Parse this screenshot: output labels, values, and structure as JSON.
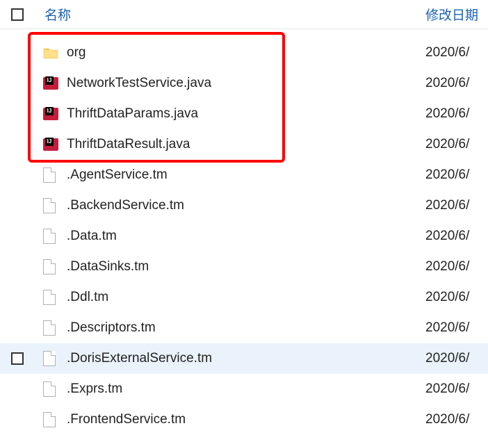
{
  "header": {
    "name_label": "名称",
    "date_label": "修改日期"
  },
  "rows": [
    {
      "type": "folder",
      "name": "org",
      "date": "2020/6/",
      "selected": false,
      "show_checkbox": false
    },
    {
      "type": "java",
      "name": "NetworkTestService.java",
      "date": "2020/6/",
      "selected": false,
      "show_checkbox": false
    },
    {
      "type": "java",
      "name": "ThriftDataParams.java",
      "date": "2020/6/",
      "selected": false,
      "show_checkbox": false
    },
    {
      "type": "java",
      "name": "ThriftDataResult.java",
      "date": "2020/6/",
      "selected": false,
      "show_checkbox": false
    },
    {
      "type": "file",
      "name": ".AgentService.tm",
      "date": "2020/6/",
      "selected": false,
      "show_checkbox": false
    },
    {
      "type": "file",
      "name": ".BackendService.tm",
      "date": "2020/6/",
      "selected": false,
      "show_checkbox": false
    },
    {
      "type": "file",
      "name": ".Data.tm",
      "date": "2020/6/",
      "selected": false,
      "show_checkbox": false
    },
    {
      "type": "file",
      "name": ".DataSinks.tm",
      "date": "2020/6/",
      "selected": false,
      "show_checkbox": false
    },
    {
      "type": "file",
      "name": ".Ddl.tm",
      "date": "2020/6/",
      "selected": false,
      "show_checkbox": false
    },
    {
      "type": "file",
      "name": ".Descriptors.tm",
      "date": "2020/6/",
      "selected": false,
      "show_checkbox": false
    },
    {
      "type": "file",
      "name": ".DorisExternalService.tm",
      "date": "2020/6/",
      "selected": true,
      "show_checkbox": true
    },
    {
      "type": "file",
      "name": ".Exprs.tm",
      "date": "2020/6/",
      "selected": false,
      "show_checkbox": false
    },
    {
      "type": "file",
      "name": ".FrontendService.tm",
      "date": "2020/6/",
      "selected": false,
      "show_checkbox": false
    }
  ],
  "ij_badge_text": "IJ"
}
